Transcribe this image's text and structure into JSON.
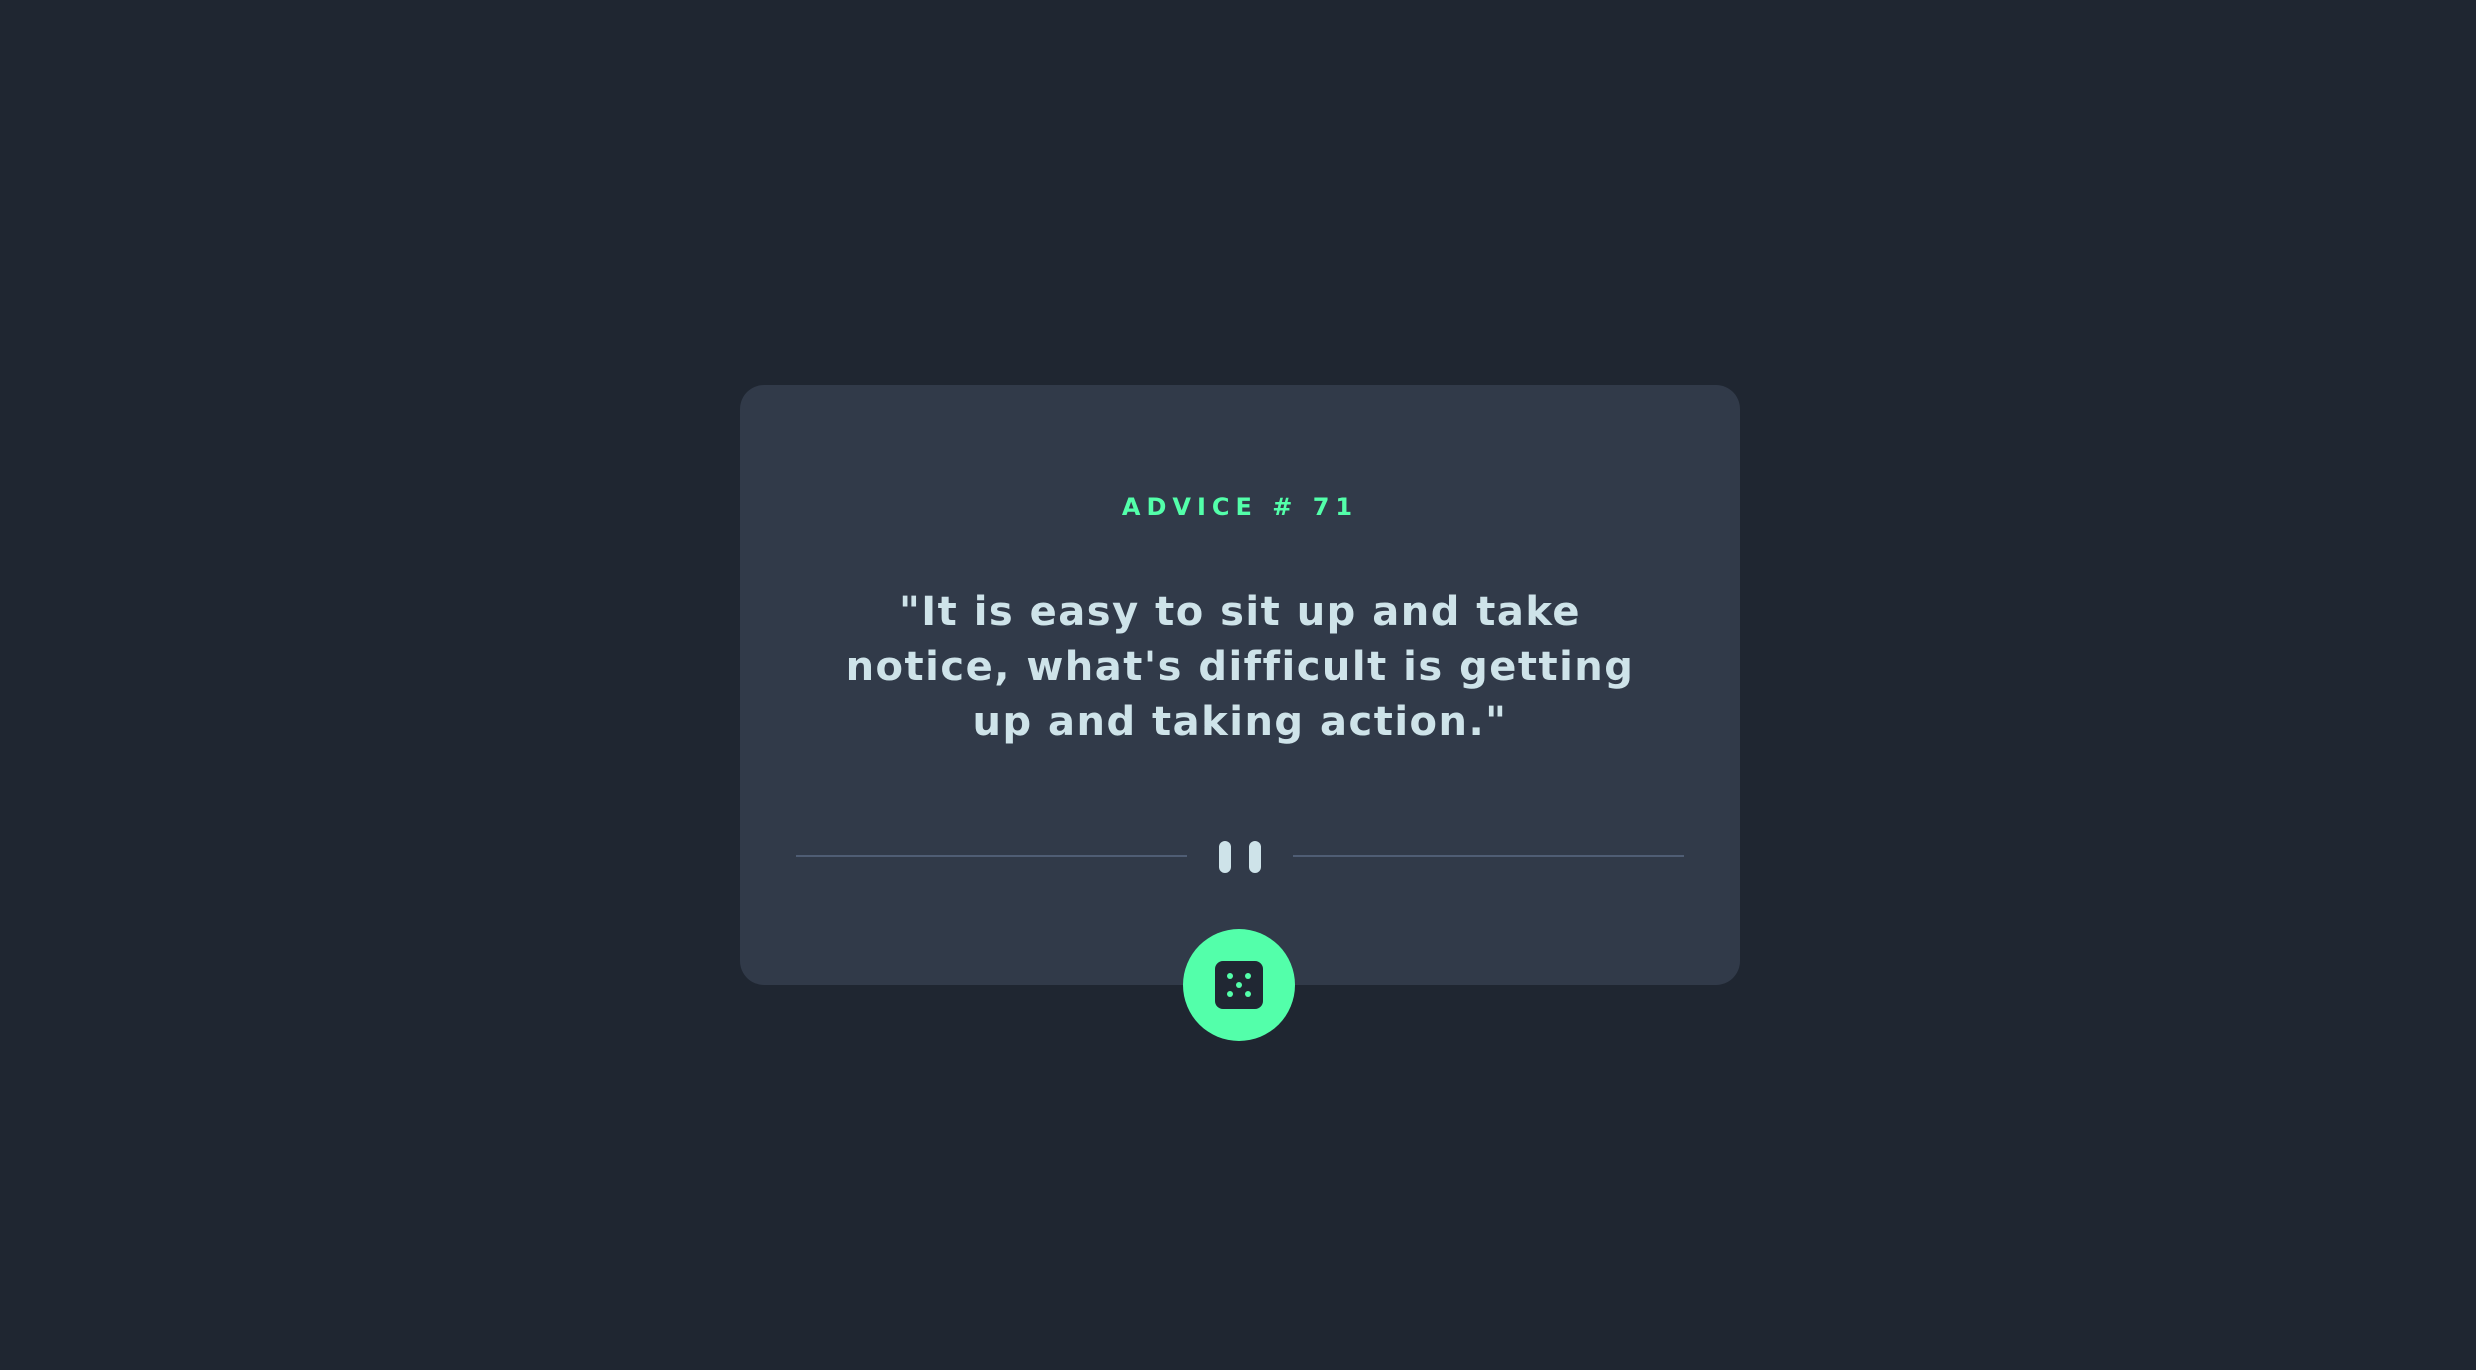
{
  "advice": {
    "label": "ADVICE # ",
    "number": "71",
    "quote": "\"It is easy to sit up and take notice, what's difficult is getting up and taking action.\""
  },
  "icons": {
    "divider": "pause-icon",
    "button": "dice-icon"
  },
  "colors": {
    "background": "#1f2631",
    "card": "#313a49",
    "accent": "#53ffaa",
    "text": "#cee3e9",
    "divider": "#4f5d74"
  }
}
